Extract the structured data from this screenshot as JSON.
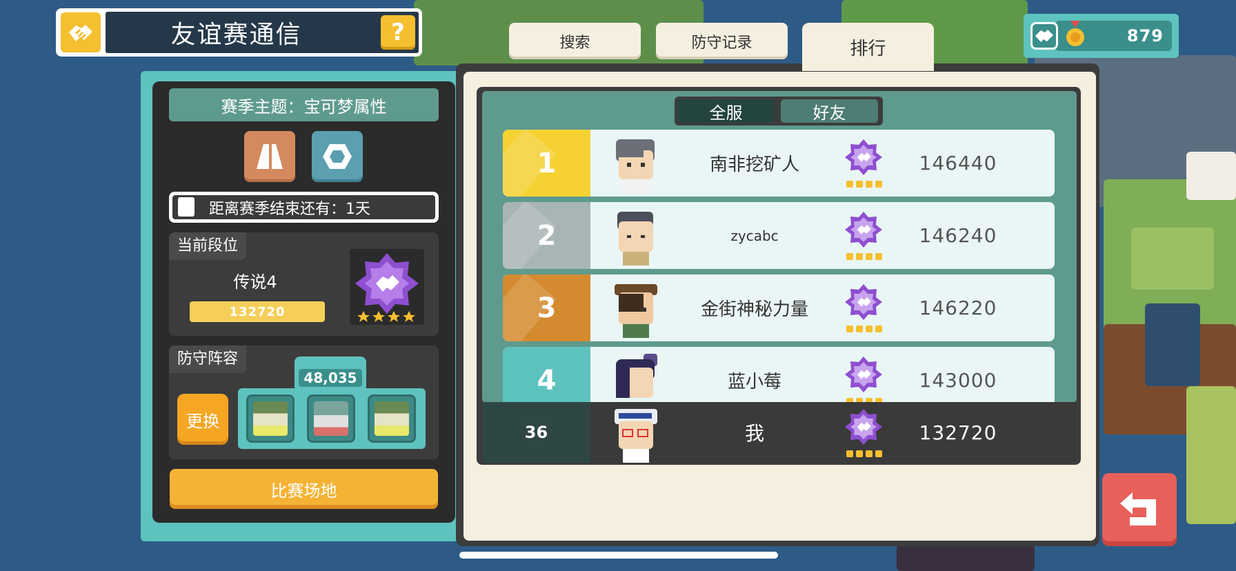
{
  "header": {
    "title": "友谊赛通信",
    "help_label": "?"
  },
  "currency": {
    "amount": "879"
  },
  "left": {
    "season_theme": "赛季主题：宝可梦属性",
    "countdown": "距离赛季结束还有：1天",
    "rank_section_label": "当前段位",
    "rank_name": "传说4",
    "rank_score": "132720",
    "defense_section_label": "防守阵容",
    "team_power": "48,035",
    "swap_label": "更换",
    "arena_label": "比赛场地"
  },
  "tabs": {
    "search": "搜索",
    "defense_log": "防守记录",
    "ranking": "排行"
  },
  "filter": {
    "all": "全服",
    "friends": "好友"
  },
  "ranking": [
    {
      "rank": "1",
      "name": "南非挖矿人",
      "score": "146440"
    },
    {
      "rank": "2",
      "name": "zycabc",
      "score": "146240"
    },
    {
      "rank": "3",
      "name": "金街神秘力量",
      "score": "146220"
    },
    {
      "rank": "4",
      "name": "蓝小莓",
      "score": "143000"
    }
  ],
  "self": {
    "rank": "36",
    "name": "我",
    "score": "132720"
  },
  "colors": {
    "teal": "#5ec3bf",
    "gold": "#f5b335",
    "badge_purple": "#9b59d6"
  }
}
